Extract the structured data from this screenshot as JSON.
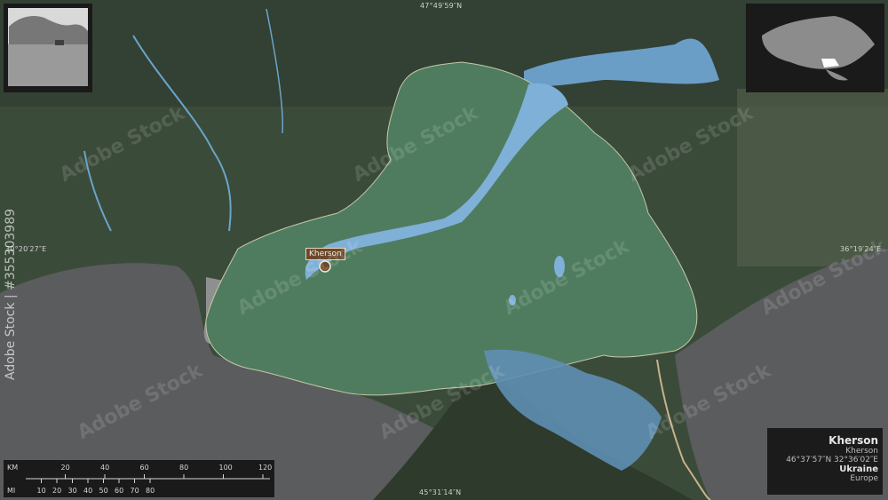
{
  "coordinates": {
    "top": "47°49′59″N",
    "bottom": "45°31′14″N",
    "left": "30°20′27″E",
    "right": "36°19′24″E"
  },
  "city": {
    "name": "Kherson"
  },
  "info": {
    "region": "Kherson",
    "region_local": "Kherson",
    "coords": "46°37′57″N 32°36′02″E",
    "country": "Ukraine",
    "continent": "Europe"
  },
  "scale": {
    "km_label": "KM",
    "mi_label": "MI",
    "km_ticks": [
      "20",
      "40",
      "60",
      "80",
      "100",
      "120"
    ],
    "mi_ticks": [
      "10",
      "20",
      "30",
      "40",
      "50",
      "60",
      "70",
      "80"
    ]
  },
  "watermark": {
    "text": "Adobe Stock",
    "side_id": "#355303989"
  },
  "colors": {
    "region_fill": "#4f7c5f",
    "water": "#7fb0d8",
    "sea": "#5b5d5e",
    "terrain": "#3a4a38",
    "label_bg": "#6b4a2b"
  }
}
